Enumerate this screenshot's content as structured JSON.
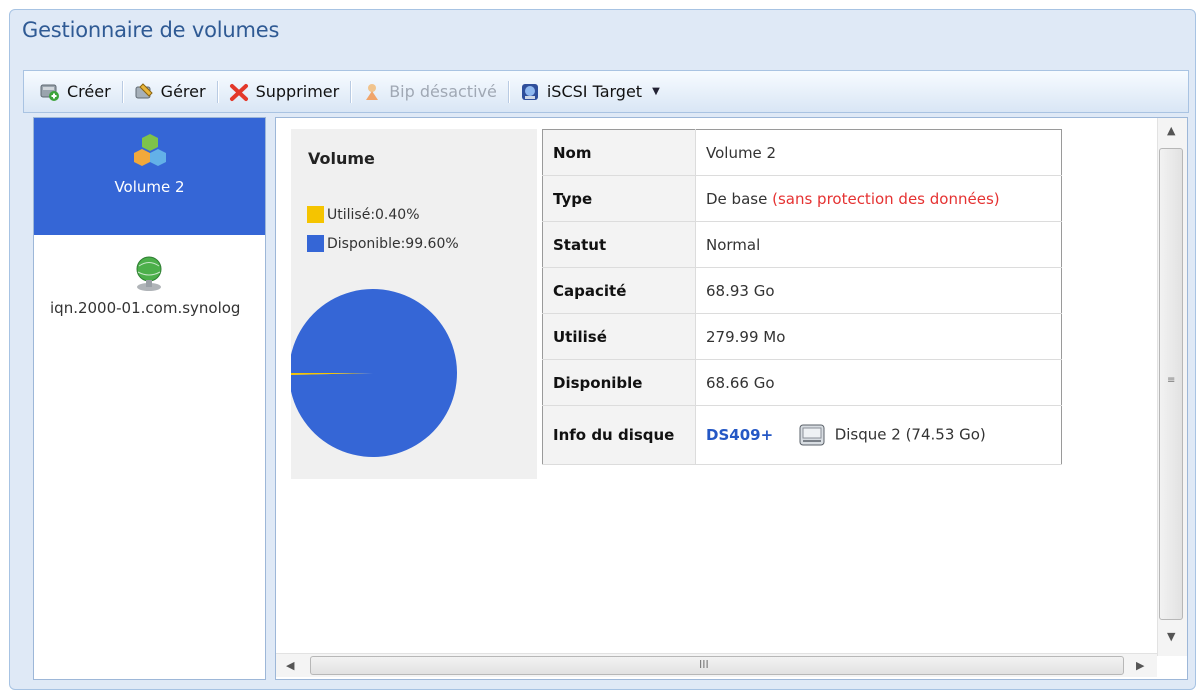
{
  "window": {
    "title": "Gestionnaire de volumes"
  },
  "toolbar": {
    "create_label": "Créer",
    "manage_label": "Gérer",
    "delete_label": "Supprimer",
    "beep_label": "Bip désactivé",
    "iscsi_label": "iSCSI Target"
  },
  "sidebar": {
    "items": [
      {
        "label": "Volume 2",
        "icon": "volume-cubes-icon",
        "selected": true
      },
      {
        "label": "iqn.2000-01.com.synolog",
        "icon": "iscsi-globe-icon",
        "selected": false
      }
    ]
  },
  "chart_data": {
    "type": "pie",
    "title": "Volume",
    "labels": [
      "Utilisé",
      "Disponible"
    ],
    "legend_text": [
      "Utilisé:0.40%",
      "Disponible:99.60%"
    ],
    "values": [
      0.4,
      99.6
    ],
    "colors": [
      "#f5c400",
      "#3566d6"
    ]
  },
  "details": {
    "rows": [
      {
        "key": "Nom",
        "value": "Volume 2"
      },
      {
        "key": "Type",
        "value": "De base",
        "note": "(sans protection des données)"
      },
      {
        "key": "Statut",
        "value": "Normal"
      },
      {
        "key": "Capacité",
        "value": "68.93 Go"
      },
      {
        "key": "Utilisé",
        "value": "279.99 Mo"
      },
      {
        "key": "Disponible",
        "value": "68.66 Go"
      },
      {
        "key": "Info du disque",
        "link": "DS409+",
        "value": "Disque 2 (74.53 Go)"
      }
    ]
  },
  "scrollbars": {
    "h_grip": "III"
  },
  "colors": {
    "accent": "#3566d6",
    "title": "#2f5a94",
    "warning": "#e53232"
  }
}
